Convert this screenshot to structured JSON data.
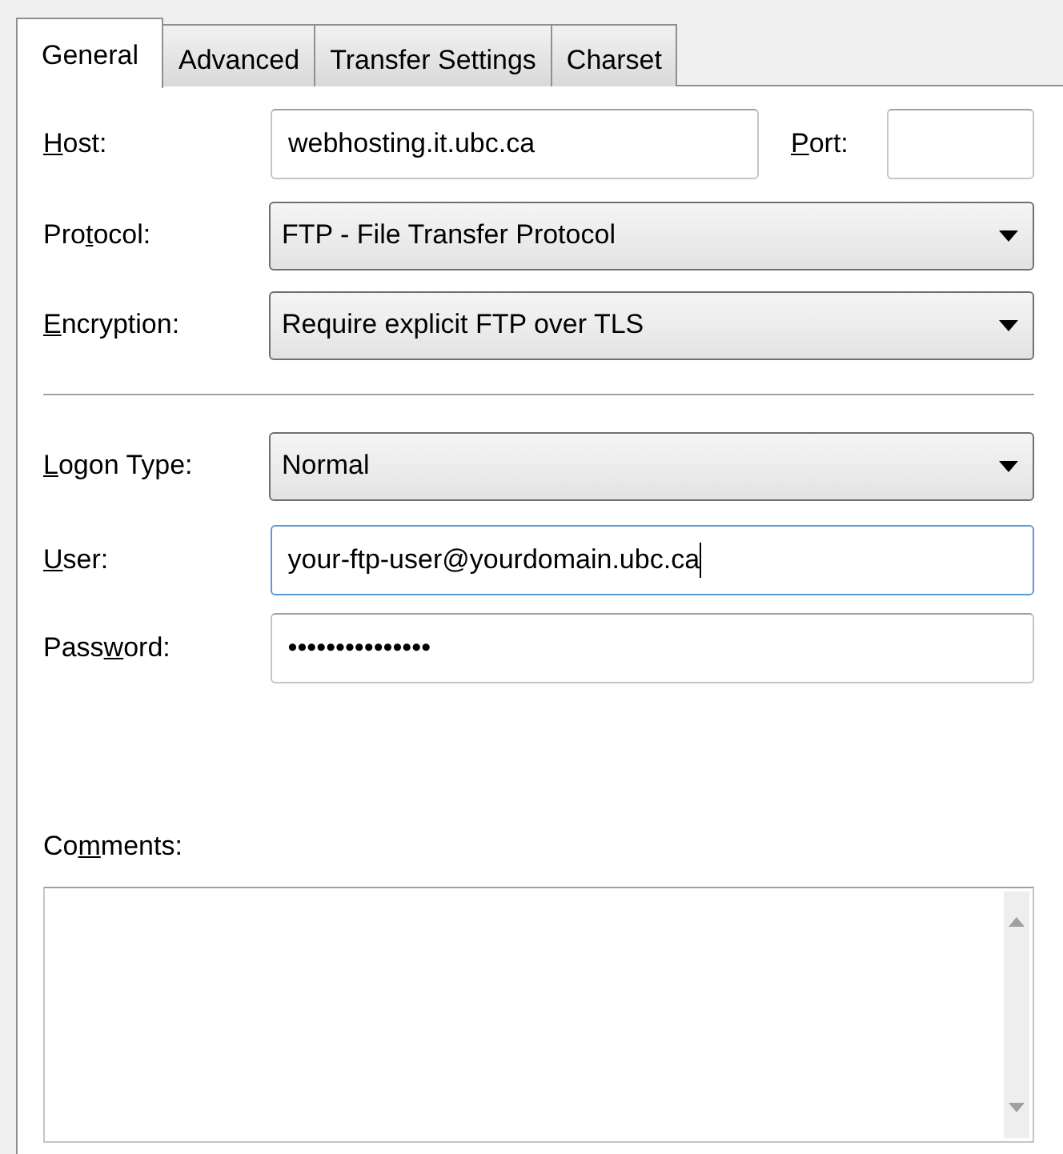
{
  "tabs": [
    {
      "label": "General",
      "selected": true
    },
    {
      "label": "Advanced",
      "selected": false
    },
    {
      "label": "Transfer Settings",
      "selected": false
    },
    {
      "label": "Charset",
      "selected": false
    }
  ],
  "host": {
    "accesskey": "H",
    "label_after": "ost:",
    "value": "webhosting.it.ubc.ca",
    "focused": false
  },
  "port": {
    "accesskey": "P",
    "label_after": "ort:",
    "focused": false
  },
  "protocol": {
    "label_before": "Pro",
    "accesskey": "t",
    "label_after": "ocol:",
    "value": "FTP - File Transfer Protocol"
  },
  "encryption": {
    "accesskey": "E",
    "label_after": "ncryption:",
    "value": "Require explicit FTP over TLS"
  },
  "logon_type": {
    "accesskey": "L",
    "label_after": "ogon Type:",
    "value": "Normal"
  },
  "user": {
    "accesskey": "U",
    "label_after": "ser:",
    "value": "your-ftp-user@yourdomain.ubc.ca",
    "focused": true
  },
  "password": {
    "label_before": "Pass",
    "accesskey": "w",
    "label_after": "ord:",
    "value": "•••••••••••••••",
    "focused": false
  },
  "comments": {
    "label_before": "Co",
    "accesskey": "m",
    "label_after": "ments:"
  }
}
